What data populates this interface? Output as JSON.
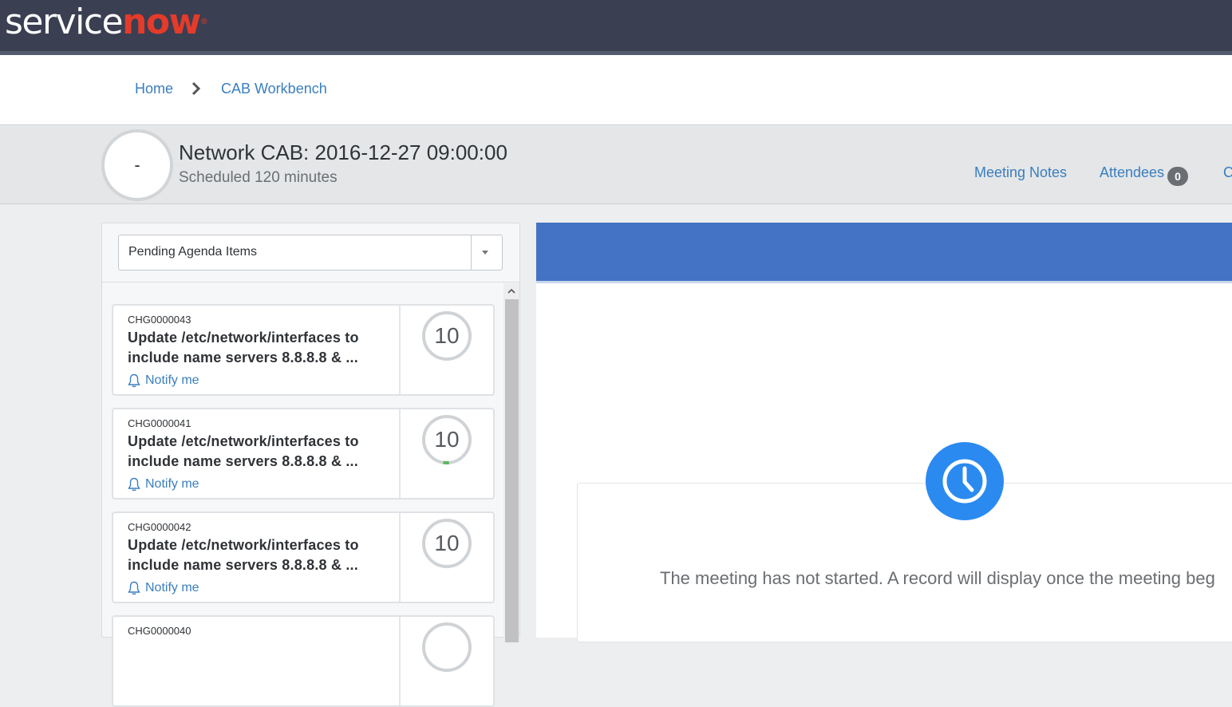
{
  "brand": {
    "logo_part1": "service",
    "logo_part2": "now",
    "logo_mark": "®"
  },
  "breadcrumb": {
    "home": "Home",
    "current": "CAB Workbench"
  },
  "meeting": {
    "timer_value": "-",
    "title": "Network CAB: 2016-12-27 09:00:00",
    "subtitle": "Scheduled 120 minutes"
  },
  "header_links": {
    "notes": "Meeting Notes",
    "attendees": "Attendees",
    "attendees_count": "0",
    "more": "C"
  },
  "agenda": {
    "filter_label": "Pending Agenda Items",
    "items": [
      {
        "number": "CHG0000043",
        "title": "Update /etc/network/interfaces to include name servers 8.8.8.8 & ...",
        "notify": "Notify me",
        "minutes": "10",
        "progress": 0
      },
      {
        "number": "CHG0000041",
        "title": "Update /etc/network/interfaces to include name servers 8.8.8.8 & ...",
        "notify": "Notify me",
        "minutes": "10",
        "progress": 0.04
      },
      {
        "number": "CHG0000042",
        "title": "Update /etc/network/interfaces to include name servers 8.8.8.8 & ...",
        "notify": "Notify me",
        "minutes": "10",
        "progress": 0
      },
      {
        "number": "CHG0000040",
        "title": "",
        "notify": "",
        "minutes": "",
        "progress": 0
      }
    ]
  },
  "record": {
    "message": "The meeting has not started. A record will display once the meeting beg"
  },
  "colors": {
    "accent": "#4472c4",
    "link": "#3a7ebf",
    "clock": "#2a8af0",
    "progress": "#5cb85c"
  }
}
